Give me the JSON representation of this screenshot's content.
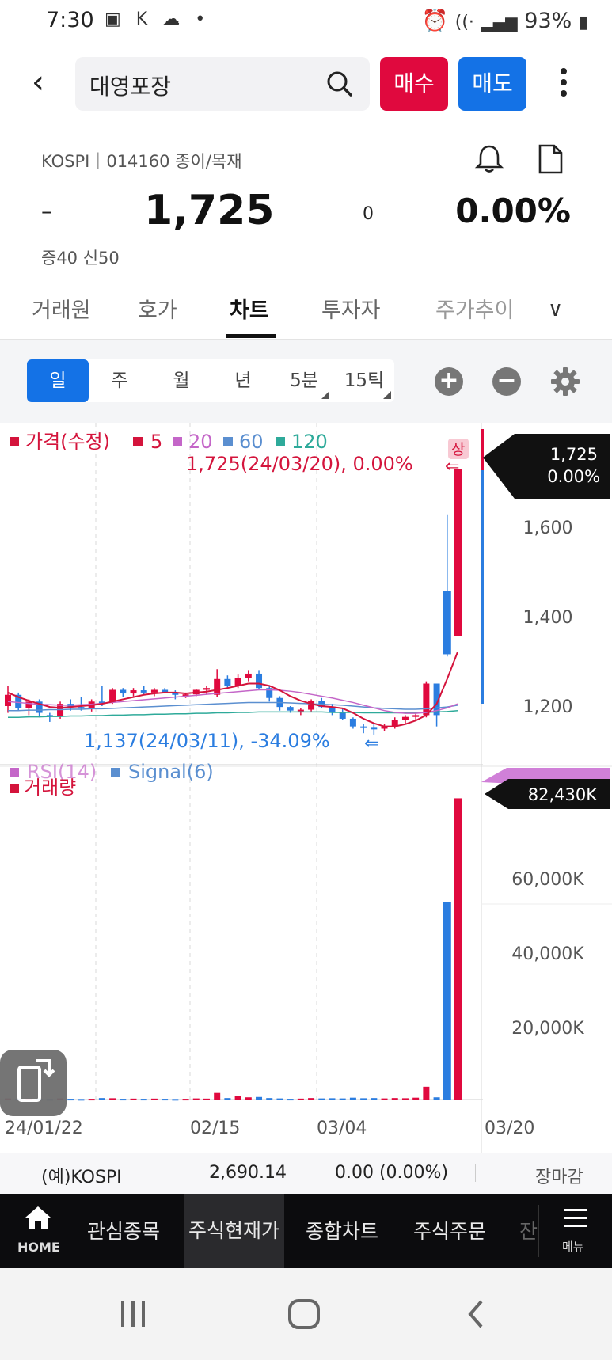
{
  "status": {
    "time": "7:30",
    "battery": "93%"
  },
  "header": {
    "search_text": "대영포장",
    "buy_label": "매수",
    "sell_label": "매도"
  },
  "quote": {
    "market_line": "KOSPI｜014160 종이/목재",
    "dash": "–",
    "price": "1,725",
    "change": "0",
    "rate": "0.00%",
    "margin_line": "증40  신50"
  },
  "tabs": [
    {
      "label": "거래원"
    },
    {
      "label": "호가"
    },
    {
      "label": "차트",
      "active": true
    },
    {
      "label": "투자자"
    },
    {
      "label": "주가추이"
    }
  ],
  "periods": [
    "일",
    "주",
    "월",
    "년",
    "5분",
    "15틱"
  ],
  "chart_labels": {
    "legend_price": [
      "가격(수정)",
      "5",
      "20",
      "60",
      "120"
    ],
    "high_note": "1,725(24/03/20), 0.00%",
    "low_note": "1,137(24/03/11), -34.09%",
    "upper_badge": "상",
    "last_price": "1,725",
    "last_rate": "0.00%",
    "rsi_legend": "RSI(14)",
    "signal_legend": "Signal(6)",
    "volume_legend": "거래량",
    "last_volume": "82,430K",
    "date_ticks": [
      "24/01/22",
      "02/15",
      "03/04",
      "03/20"
    ],
    "price_ticks": [
      "1,600",
      "1,400",
      "1,200"
    ],
    "volume_ticks": [
      "60,000K",
      "40,000K",
      "20,000K"
    ]
  },
  "chart_data": {
    "type": "candlestick",
    "price_axis": [
      1100,
      1760
    ],
    "volume_axis": [
      0,
      85000
    ],
    "ma_colors": {
      "ma5": "#d4143c",
      "ma20": "#c466c8",
      "ma60": "#5b8fd0",
      "ma120": "#2eaa9a"
    },
    "candles": [
      {
        "o": 1200,
        "h": 1245,
        "l": 1185,
        "c": 1225
      },
      {
        "o": 1225,
        "h": 1230,
        "l": 1190,
        "c": 1195
      },
      {
        "o": 1195,
        "h": 1215,
        "l": 1180,
        "c": 1210
      },
      {
        "o": 1210,
        "h": 1215,
        "l": 1175,
        "c": 1185
      },
      {
        "o": 1180,
        "h": 1185,
        "l": 1165,
        "c": 1178
      },
      {
        "o": 1178,
        "h": 1210,
        "l": 1172,
        "c": 1205
      },
      {
        "o": 1205,
        "h": 1215,
        "l": 1190,
        "c": 1198
      },
      {
        "o": 1198,
        "h": 1220,
        "l": 1190,
        "c": 1195
      },
      {
        "o": 1195,
        "h": 1215,
        "l": 1188,
        "c": 1210
      },
      {
        "o": 1210,
        "h": 1245,
        "l": 1200,
        "c": 1208
      },
      {
        "o": 1208,
        "h": 1240,
        "l": 1205,
        "c": 1236
      },
      {
        "o": 1236,
        "h": 1240,
        "l": 1220,
        "c": 1228
      },
      {
        "o": 1228,
        "h": 1240,
        "l": 1222,
        "c": 1235
      },
      {
        "o": 1235,
        "h": 1245,
        "l": 1225,
        "c": 1230
      },
      {
        "o": 1230,
        "h": 1240,
        "l": 1222,
        "c": 1236
      },
      {
        "o": 1236,
        "h": 1240,
        "l": 1228,
        "c": 1230
      },
      {
        "o": 1230,
        "h": 1235,
        "l": 1215,
        "c": 1225
      },
      {
        "o": 1225,
        "h": 1230,
        "l": 1218,
        "c": 1226
      },
      {
        "o": 1226,
        "h": 1238,
        "l": 1222,
        "c": 1236
      },
      {
        "o": 1236,
        "h": 1245,
        "l": 1225,
        "c": 1240
      },
      {
        "o": 1225,
        "h": 1282,
        "l": 1220,
        "c": 1260
      },
      {
        "o": 1260,
        "h": 1268,
        "l": 1240,
        "c": 1245
      },
      {
        "o": 1245,
        "h": 1270,
        "l": 1240,
        "c": 1262
      },
      {
        "o": 1262,
        "h": 1280,
        "l": 1255,
        "c": 1272
      },
      {
        "o": 1272,
        "h": 1280,
        "l": 1235,
        "c": 1240
      },
      {
        "o": 1240,
        "h": 1245,
        "l": 1210,
        "c": 1218
      },
      {
        "o": 1218,
        "h": 1222,
        "l": 1190,
        "c": 1198
      },
      {
        "o": 1198,
        "h": 1200,
        "l": 1185,
        "c": 1190
      },
      {
        "o": 1190,
        "h": 1195,
        "l": 1180,
        "c": 1192
      },
      {
        "o": 1192,
        "h": 1215,
        "l": 1188,
        "c": 1212
      },
      {
        "o": 1212,
        "h": 1218,
        "l": 1195,
        "c": 1198
      },
      {
        "o": 1198,
        "h": 1205,
        "l": 1180,
        "c": 1185
      },
      {
        "o": 1185,
        "h": 1195,
        "l": 1170,
        "c": 1172
      },
      {
        "o": 1172,
        "h": 1175,
        "l": 1150,
        "c": 1155
      },
      {
        "o": 1155,
        "h": 1160,
        "l": 1140,
        "c": 1152
      },
      {
        "o": 1152,
        "h": 1160,
        "l": 1137,
        "c": 1150
      },
      {
        "o": 1150,
        "h": 1160,
        "l": 1145,
        "c": 1155
      },
      {
        "o": 1155,
        "h": 1175,
        "l": 1150,
        "c": 1170
      },
      {
        "o": 1170,
        "h": 1180,
        "l": 1162,
        "c": 1176
      },
      {
        "o": 1176,
        "h": 1185,
        "l": 1170,
        "c": 1180
      },
      {
        "o": 1180,
        "h": 1255,
        "l": 1175,
        "c": 1250
      },
      {
        "o": 1250,
        "h": 1250,
        "l": 1155,
        "c": 1180
      },
      {
        "o": 1455,
        "h": 1625,
        "l": 1310,
        "c": 1315
      },
      {
        "o": 1355,
        "h": 1725,
        "l": 1355,
        "c": 1725
      }
    ],
    "ma5": [
      1230,
      1220,
      1212,
      1205,
      1198,
      1196,
      1198,
      1200,
      1202,
      1205,
      1210,
      1215,
      1220,
      1225,
      1228,
      1230,
      1230,
      1228,
      1230,
      1232,
      1236,
      1240,
      1245,
      1250,
      1250,
      1245,
      1235,
      1222,
      1212,
      1205,
      1200,
      1198,
      1195,
      1185,
      1172,
      1162,
      1155,
      1155,
      1160,
      1168,
      1180,
      1205,
      1260,
      1320
    ],
    "ma20": [
      1210,
      1208,
      1206,
      1204,
      1203,
      1202,
      1202,
      1203,
      1204,
      1206,
      1208,
      1210,
      1212,
      1214,
      1216,
      1218,
      1220,
      1222,
      1224,
      1226,
      1228,
      1230,
      1232,
      1234,
      1236,
      1236,
      1235,
      1233,
      1230,
      1226,
      1222,
      1218,
      1213,
      1208,
      1202,
      1196,
      1190,
      1186,
      1184,
      1184,
      1186,
      1190,
      1196,
      1205
    ],
    "ma60": [
      1190,
      1190,
      1191,
      1191,
      1192,
      1192,
      1193,
      1193,
      1194,
      1194,
      1195,
      1196,
      1197,
      1198,
      1199,
      1200,
      1201,
      1202,
      1203,
      1204,
      1205,
      1206,
      1207,
      1208,
      1208,
      1208,
      1208,
      1207,
      1206,
      1205,
      1204,
      1203,
      1202,
      1200,
      1198,
      1196,
      1195,
      1194,
      1193,
      1193,
      1194,
      1196,
      1198,
      1202
    ],
    "ma120": [
      1175,
      1175,
      1176,
      1176,
      1177,
      1177,
      1178,
      1178,
      1179,
      1179,
      1180,
      1180,
      1181,
      1181,
      1182,
      1182,
      1183,
      1183,
      1184,
      1184,
      1185,
      1185,
      1186,
      1186,
      1187,
      1187,
      1187,
      1187,
      1187,
      1187,
      1187,
      1186,
      1186,
      1186,
      1185,
      1185,
      1185,
      1185,
      1185,
      1186,
      1186,
      1187,
      1188,
      1190
    ],
    "volumes": [
      300,
      200,
      250,
      200,
      150,
      300,
      200,
      150,
      200,
      400,
      350,
      200,
      250,
      200,
      250,
      200,
      150,
      200,
      300,
      250,
      1800,
      400,
      900,
      600,
      700,
      400,
      300,
      200,
      250,
      400,
      300,
      350,
      300,
      500,
      350,
      400,
      300,
      400,
      350,
      500,
      3500,
      600,
      54000,
      82430
    ]
  },
  "kospi": {
    "name": "(예)KOSPI",
    "value": "2,690.14",
    "change": "0.00 (0.00%)",
    "status": "장마감"
  },
  "nav": {
    "home": "HOME",
    "items": [
      "관심종목",
      "주식현재가",
      "종합차트",
      "주식주문",
      "잔"
    ],
    "menu": "메뉴"
  }
}
